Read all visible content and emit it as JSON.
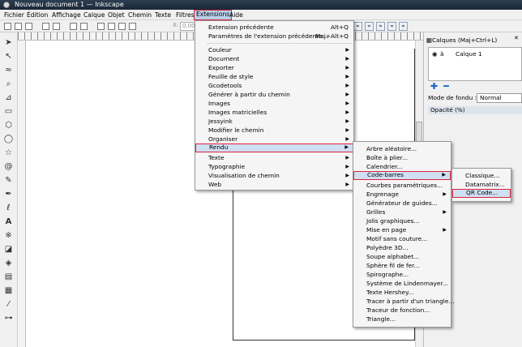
{
  "window": {
    "title": "Nouveau document 1 — Inkscape"
  },
  "menubar": [
    "Fichier",
    "Édition",
    "Affichage",
    "Calque",
    "Objet",
    "Chemin",
    "Texte",
    "Filtres",
    "Extensions",
    "Aide"
  ],
  "toolbar": {
    "x_label": "X:",
    "x_value": "0,000"
  },
  "layers_panel": {
    "tab_label": "Calques (Maj+Ctrl+L)",
    "layer_name": "Calque 1",
    "blend_label": "Mode de fondu :",
    "blend_value": "Normal",
    "opacity_label": "Opacité (%)"
  },
  "extensions_menu": {
    "top": [
      {
        "label": "Extension précédente",
        "shortcut": "Alt+Q"
      },
      {
        "label": "Paramètres de l'extension précédente...",
        "shortcut": "Maj+Alt+Q"
      }
    ],
    "items": [
      "Couleur",
      "Document",
      "Exporter",
      "Feuille de style",
      "Gcodetools",
      "Générer à partir du chemin",
      "Images",
      "Images matricielles",
      "Jessyink",
      "Modifier le chemin",
      "Organiser",
      "Rendu",
      "Texte",
      "Typographie",
      "Visualisation de chemin",
      "Web"
    ]
  },
  "rendu_menu": {
    "items": [
      "Arbre aléatoire...",
      "Boîte à plier...",
      "Calendrier...",
      "Code-barres",
      "Courbes paramétriques...",
      "Engrenage",
      "Générateur de guides...",
      "Grilles",
      "Jolis graphiques...",
      "Mise en page",
      "Motif sans couture...",
      "Polyèdre 3D...",
      "Soupe alphabet...",
      "Sphère fil de fer...",
      "Spirographe...",
      "Système de Lindenmayer...",
      "Texte Hershey...",
      "Tracer à partir d'un triangle...",
      "Traceur de fonction...",
      "Triangle..."
    ]
  },
  "codebarres_menu": {
    "items": [
      "Classique...",
      "Datamatrix...",
      "QR Code..."
    ]
  }
}
